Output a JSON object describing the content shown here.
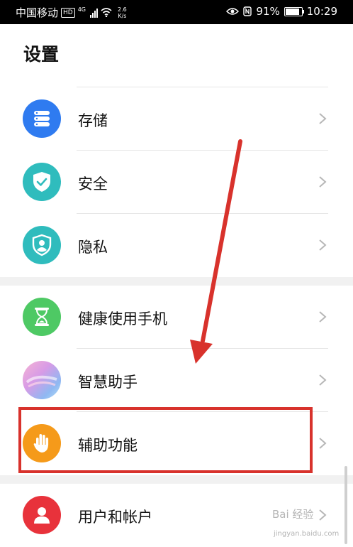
{
  "status_bar": {
    "carrier": "中国移动",
    "hd": "HD",
    "network": "4G",
    "speed_value": "2.6",
    "speed_unit": "K/s",
    "battery": "91%",
    "time": "10:29"
  },
  "page": {
    "title": "设置"
  },
  "items": [
    {
      "label": "存储",
      "icon": "storage-icon",
      "color": "#2f7bf0"
    },
    {
      "label": "安全",
      "icon": "shield-check-icon",
      "color": "#2fbcbd"
    },
    {
      "label": "隐私",
      "icon": "privacy-icon",
      "color": "#2fbcbd"
    },
    {
      "label": "健康使用手机",
      "icon": "hourglass-icon",
      "color": "#4ec964"
    },
    {
      "label": "智慧助手",
      "icon": "assistant-icon",
      "color": "#c27bdc"
    },
    {
      "label": "辅助功能",
      "icon": "hand-icon",
      "color": "#f59a1a"
    },
    {
      "label": "用户和帐户",
      "icon": "user-icon",
      "color": "#e8323b"
    }
  ],
  "watermark": {
    "text": "Bai 经验",
    "sub": "jingyan.baidu.com"
  }
}
